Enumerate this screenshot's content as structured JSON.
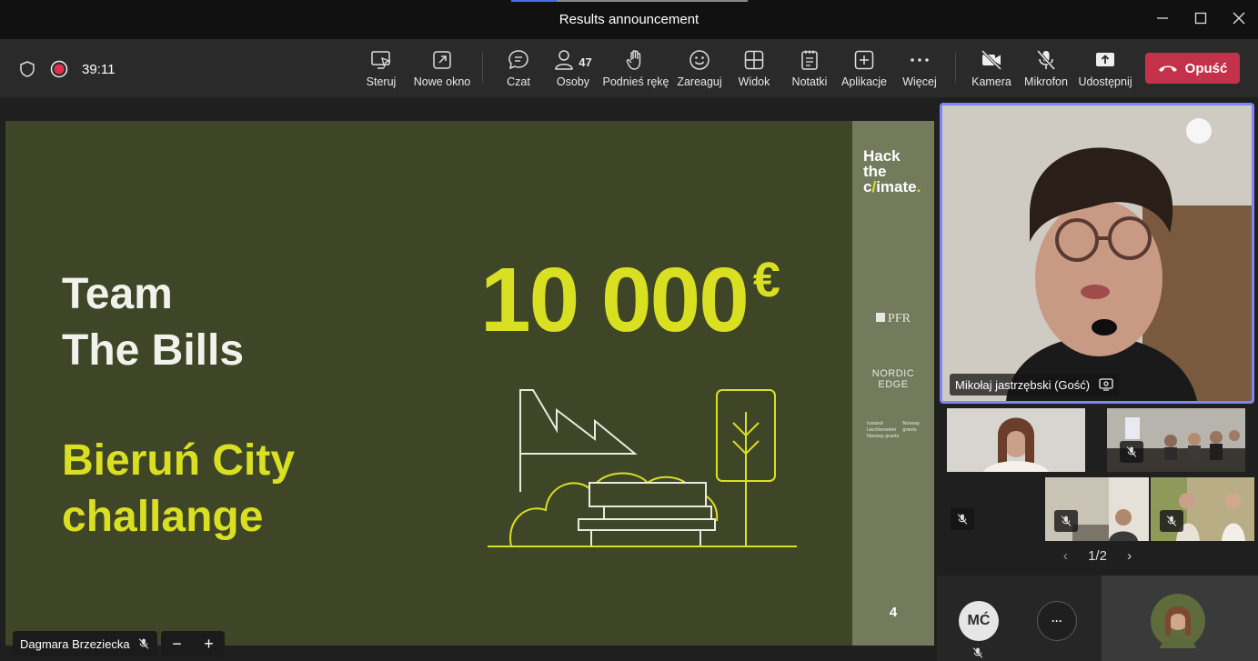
{
  "window": {
    "title": "Results announcement"
  },
  "toolbar": {
    "timer": "39:11",
    "buttons": {
      "control": "Steruj",
      "new_window": "Nowe okno",
      "chat": "Czat",
      "people": "Osoby",
      "people_count": "47",
      "raise_hand": "Podnieś rękę",
      "react": "Zareaguj",
      "view": "Widok",
      "notes": "Notatki",
      "apps": "Aplikacje",
      "more": "Więcej",
      "camera": "Kamera",
      "mic": "Mikrofon",
      "share": "Udostępnij",
      "leave": "Opuść"
    },
    "leave_color": "#c4314b"
  },
  "slide": {
    "team_line1": "Team",
    "team_line2": "The Bills",
    "challenge_line1": "Bieruń City",
    "challenge_line2": "challange",
    "prize_amount": "10 000",
    "prize_currency": "€",
    "brand_line1": "Hack",
    "brand_line2": "the",
    "brand_line3_a": "c",
    "brand_line3_b": "/",
    "brand_line3_c": "imate",
    "brand_line3_dot": ".",
    "sponsor1": "PFR",
    "sponsor2_a": "NORDIC",
    "sponsor2_b": "EDGE",
    "sponsor3_a": "Iceland",
    "sponsor3_b": "Liechtenstein",
    "sponsor3_c": "Norway grants",
    "sponsor3_d": "Norway",
    "sponsor3_e": "grants",
    "page_number": "4",
    "accent": "#d9e021",
    "background": "#3f4527"
  },
  "stage": {
    "presenter_name": "Dagmara Brzeziecka"
  },
  "gallery": {
    "main_speaker": "Mikołaj jastrzębski (Gość)",
    "page_indicator": "1/2",
    "avatar_initials": "MĆ",
    "more_label": "···"
  }
}
